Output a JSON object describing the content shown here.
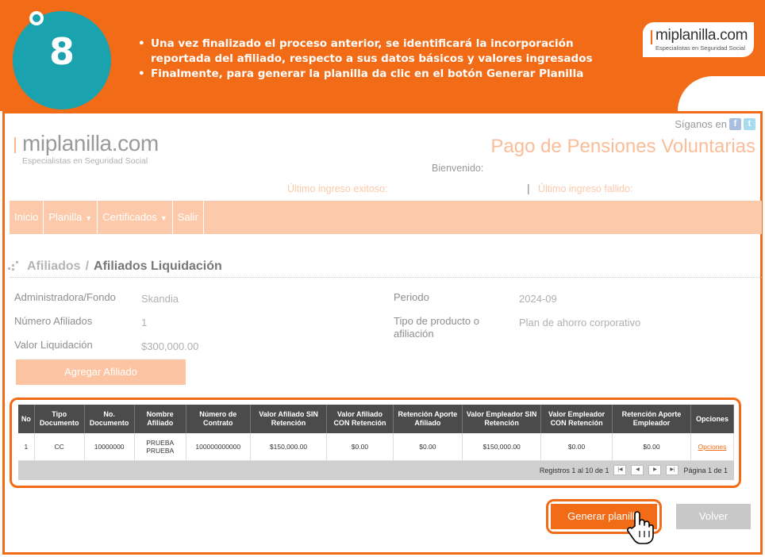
{
  "banner": {
    "step": "8",
    "bullet_1": "Una vez finalizado el proceso anterior, se identificará la incorporación reportada del afiliado, respecto a sus datos básicos y valores ingresados",
    "bullet_2_prefix": "Finalmente, para generar la planilla da clic en el botón ",
    "bullet_2_strong": "Generar Planilla",
    "brand_name": "miplanilla.com",
    "brand_tagline": "Especialistas en Seguridad Social"
  },
  "site": {
    "logo_name": "miplanilla.com",
    "logo_tagline": "Especialistas en Seguridad Social",
    "follow_label": "Síganos en",
    "page_title": "Pago de Pensiones Voluntarias",
    "welcome_label": "Bienvenido:",
    "last_success_label": "Último ingreso exitoso:",
    "last_fail_label": "Último ingreso fallido:",
    "social_icons": [
      "facebook-icon",
      "twitter-icon"
    ],
    "accent_color": "#f26b16"
  },
  "nav": {
    "items": [
      {
        "label": "Inicio",
        "has_caret": false
      },
      {
        "label": "Planilla",
        "has_caret": true
      },
      {
        "label": "Certificados",
        "has_caret": true
      },
      {
        "label": "Salir",
        "has_caret": false
      }
    ]
  },
  "breadcrumb": {
    "parent": "Afiliados",
    "separator": "/",
    "current": "Afiliados Liquidación"
  },
  "summary": {
    "fund_label": "Administradora/Fondo",
    "fund_value": "Skandia",
    "count_label": "Número Afiliados",
    "count_value": "1",
    "total_label": "Valor Liquidación",
    "total_value": "$300,000.00",
    "period_label": "Periodo",
    "period_value": "2024-09",
    "product_label": "Tipo de producto o afiliación",
    "product_value": "Plan de ahorro corporativo"
  },
  "add_button": "Agregar Afiliado",
  "table": {
    "headers": [
      "No",
      "Tipo Documento",
      "No. Documento",
      "Nombre Afiliado",
      "Número de Contrato",
      "Valor Afiliado SIN Retención",
      "Valor Afiliado CON Retención",
      "Retención Aporte Afiliado",
      "Valor Empleador SIN Retención",
      "Valor Empleador CON Retención",
      "Retención Aporte Empleador",
      "Opciones"
    ],
    "rows": [
      {
        "no": "1",
        "tipo": "CC",
        "documento": "10000000",
        "nombre": "PRUEBA PRUEBA",
        "contrato": "100000000000",
        "afiliado_sin": "$150,000.00",
        "afiliado_con": "$0.00",
        "ret_afiliado": "$0.00",
        "empleador_sin": "$150,000.00",
        "empleador_con": "$0.00",
        "ret_empleador": "$0.00",
        "opciones": "Opciones"
      }
    ],
    "records_text": "Registros 1 al 10 de 1",
    "page_text": "Página 1 de 1"
  },
  "generate_button": "Generar planilla",
  "back_button": "Volver"
}
